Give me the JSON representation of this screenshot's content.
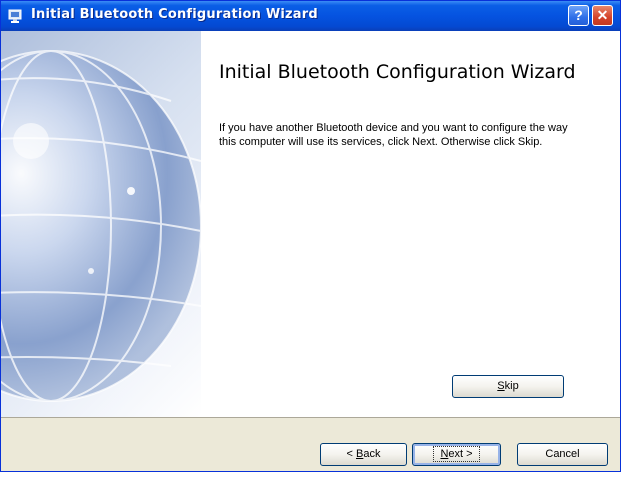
{
  "window": {
    "title": "Initial Bluetooth Configuration Wizard",
    "help_glyph": "?",
    "close_glyph": "✕"
  },
  "main": {
    "heading": "Initial Bluetooth Configuration Wizard",
    "description": "If you have another Bluetooth device and you want to configure the way this computer will use its services, click Next. Otherwise click Skip."
  },
  "buttons": {
    "skip": {
      "accel": "S",
      "rest": "kip"
    },
    "back": {
      "prefix": "< ",
      "accel": "B",
      "rest": "ack"
    },
    "next": {
      "accel": "N",
      "rest": "ext >"
    },
    "cancel": "Cancel"
  },
  "icons": {
    "app": "bluetooth-wizard-icon",
    "help": "help-icon",
    "close": "close-icon",
    "sidebar": "globe-graphic"
  },
  "colors": {
    "titlebar": "#0553e0",
    "footer": "#ece9d8",
    "close_button": "#d4432a"
  }
}
